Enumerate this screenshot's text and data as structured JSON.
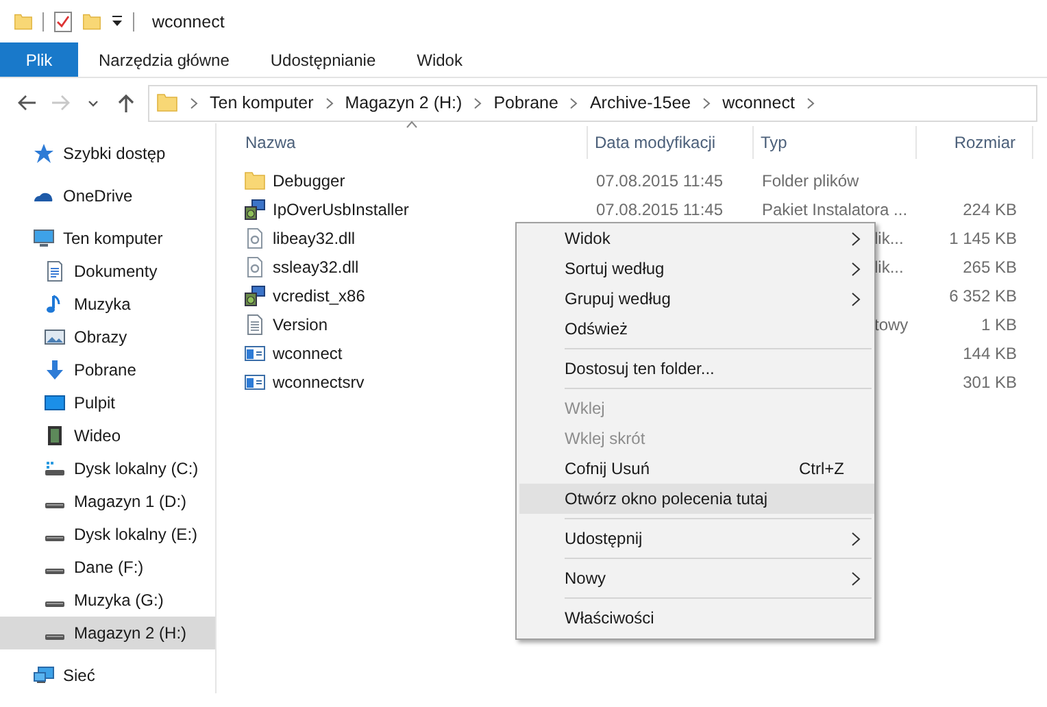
{
  "title_bar": {
    "title": "wconnect"
  },
  "ribbon": {
    "tabs": [
      {
        "label": "Plik",
        "kind": "file"
      },
      {
        "label": "Narzędzia główne",
        "kind": "tab"
      },
      {
        "label": "Udostępnianie",
        "kind": "tab"
      },
      {
        "label": "Widok",
        "kind": "tab"
      }
    ]
  },
  "address_bar": {
    "buttons": [
      {
        "kind": "back",
        "disabled": false
      },
      {
        "kind": "forward",
        "disabled": true
      },
      {
        "kind": "recent",
        "disabled": false
      },
      {
        "kind": "up",
        "disabled": false
      }
    ],
    "path": [
      "Ten komputer",
      "Magazyn 2 (H:)",
      "Pobrane",
      "Archive-15ee",
      "wconnect"
    ]
  },
  "navigation": {
    "items": [
      {
        "label": "Szybki dostęp",
        "kind": "star",
        "selected": false
      },
      {
        "label": "OneDrive",
        "kind": "cloud",
        "selected": false
      },
      {
        "label": "Ten komputer",
        "kind": "computer",
        "selected": false,
        "children": [
          {
            "label": "Dokumenty",
            "kind": "documents",
            "selected": false
          },
          {
            "label": "Muzyka",
            "kind": "music",
            "selected": false
          },
          {
            "label": "Obrazy",
            "kind": "pictures",
            "selected": false
          },
          {
            "label": "Pobrane",
            "kind": "downloads",
            "selected": false
          },
          {
            "label": "Pulpit",
            "kind": "desktop",
            "selected": false
          },
          {
            "label": "Wideo",
            "kind": "video",
            "selected": false
          },
          {
            "label": "Dysk lokalny (C:)",
            "kind": "system-drive",
            "selected": false
          },
          {
            "label": "Magazyn 1 (D:)",
            "kind": "drive",
            "selected": false
          },
          {
            "label": "Dysk lokalny (E:)",
            "kind": "drive",
            "selected": false
          },
          {
            "label": "Dane (F:)",
            "kind": "drive",
            "selected": false
          },
          {
            "label": "Muzyka (G:)",
            "kind": "drive",
            "selected": false
          },
          {
            "label": "Magazyn 2 (H:)",
            "kind": "drive",
            "selected": true
          }
        ]
      },
      {
        "label": "Sieć",
        "kind": "network",
        "selected": false
      }
    ]
  },
  "file_list": {
    "columns": [
      "Nazwa",
      "Data modyfikacji",
      "Typ",
      "Rozmiar"
    ],
    "rows": [
      {
        "name": "Debugger",
        "kind": "folder",
        "date": "07.08.2015 11:45",
        "type": "Folder plików"
      },
      {
        "name": "IpOverUsbInstaller",
        "kind": "installer",
        "date": "07.08.2015 11:45",
        "type": "Pakiet Instalatora ...",
        "size": "224 KB"
      },
      {
        "name": "libeay32.dll",
        "kind": "dll",
        "type": "lik...",
        "type_partial": true,
        "size": "1 145 KB"
      },
      {
        "name": "ssleay32.dll",
        "kind": "dll",
        "type": "lik...",
        "type_partial": true,
        "size": "265 KB"
      },
      {
        "name": "vcredist_x86",
        "kind": "installer",
        "size": "6 352 KB"
      },
      {
        "name": "Version",
        "kind": "text",
        "type": "towy",
        "type_partial": true,
        "size": "1 KB"
      },
      {
        "name": "wconnect",
        "kind": "app",
        "size": "144 KB"
      },
      {
        "name": "wconnectsrv",
        "kind": "app",
        "size": "301 KB"
      }
    ]
  },
  "context_menu": {
    "items": [
      {
        "kind": "item",
        "label": "Widok",
        "submenu": true,
        "disabled": false,
        "selected": false
      },
      {
        "kind": "item",
        "label": "Sortuj według",
        "submenu": true,
        "disabled": false,
        "selected": false
      },
      {
        "kind": "item",
        "label": "Grupuj według",
        "submenu": true,
        "disabled": false,
        "selected": false
      },
      {
        "kind": "item",
        "label": "Odśwież",
        "submenu": false,
        "disabled": false,
        "selected": false
      },
      {
        "kind": "separator"
      },
      {
        "kind": "item",
        "label": "Dostosuj ten folder...",
        "submenu": false,
        "disabled": false,
        "selected": false
      },
      {
        "kind": "separator"
      },
      {
        "kind": "item",
        "label": "Wklej",
        "submenu": false,
        "disabled": true,
        "selected": false
      },
      {
        "kind": "item",
        "label": "Wklej skrót",
        "submenu": false,
        "disabled": true,
        "selected": false
      },
      {
        "kind": "item",
        "label": "Cofnij Usuń",
        "shortcut": "Ctrl+Z",
        "submenu": false,
        "disabled": false,
        "selected": false
      },
      {
        "kind": "item",
        "label": "Otwórz okno polecenia tutaj",
        "submenu": false,
        "disabled": false,
        "selected": true
      },
      {
        "kind": "separator"
      },
      {
        "kind": "item",
        "label": "Udostępnij",
        "submenu": true,
        "disabled": false,
        "selected": false
      },
      {
        "kind": "separator"
      },
      {
        "kind": "item",
        "label": "Nowy",
        "submenu": true,
        "disabled": false,
        "selected": false
      },
      {
        "kind": "separator"
      },
      {
        "kind": "item",
        "label": "Właściwości",
        "submenu": false,
        "disabled": false,
        "selected": false
      }
    ]
  }
}
